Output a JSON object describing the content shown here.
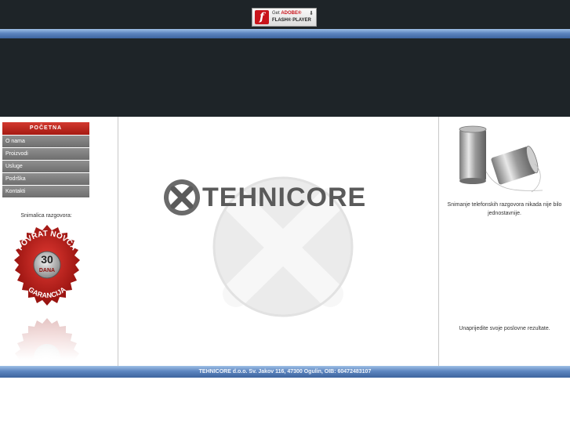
{
  "flash": {
    "get_label": "Get",
    "adobe_label": "ADOBE®",
    "product_label": "FLASH® PLAYER",
    "logo_glyph": "f"
  },
  "nav": {
    "items": [
      "POČETNA",
      "O nama",
      "Proizvodi",
      "Usluge",
      "Podrška",
      "Kontakti"
    ]
  },
  "sidebar": {
    "label": "Snimalica razgovora:",
    "badge_top": "POVRAT NOVCA",
    "badge_number": "30",
    "badge_days": "DANA",
    "badge_bottom": "GARANCIJA"
  },
  "logo": {
    "text": "TEHNICORE"
  },
  "right": {
    "text1": "Snimanje telefonskih razgovora nikada nije bilo jednostavnije.",
    "text2": "Unaprijedite svoje poslovne rezultate."
  },
  "footer": {
    "text": "TEHNICORE d.o.o. Sv. Jakov 116, 47300 Ogulin, OIB: 60472483107"
  },
  "colors": {
    "dark": "#1e2428",
    "nav_active": "#c0281f",
    "nav_item": "#7d7d7d",
    "bar_blue": "#5d86c0"
  }
}
